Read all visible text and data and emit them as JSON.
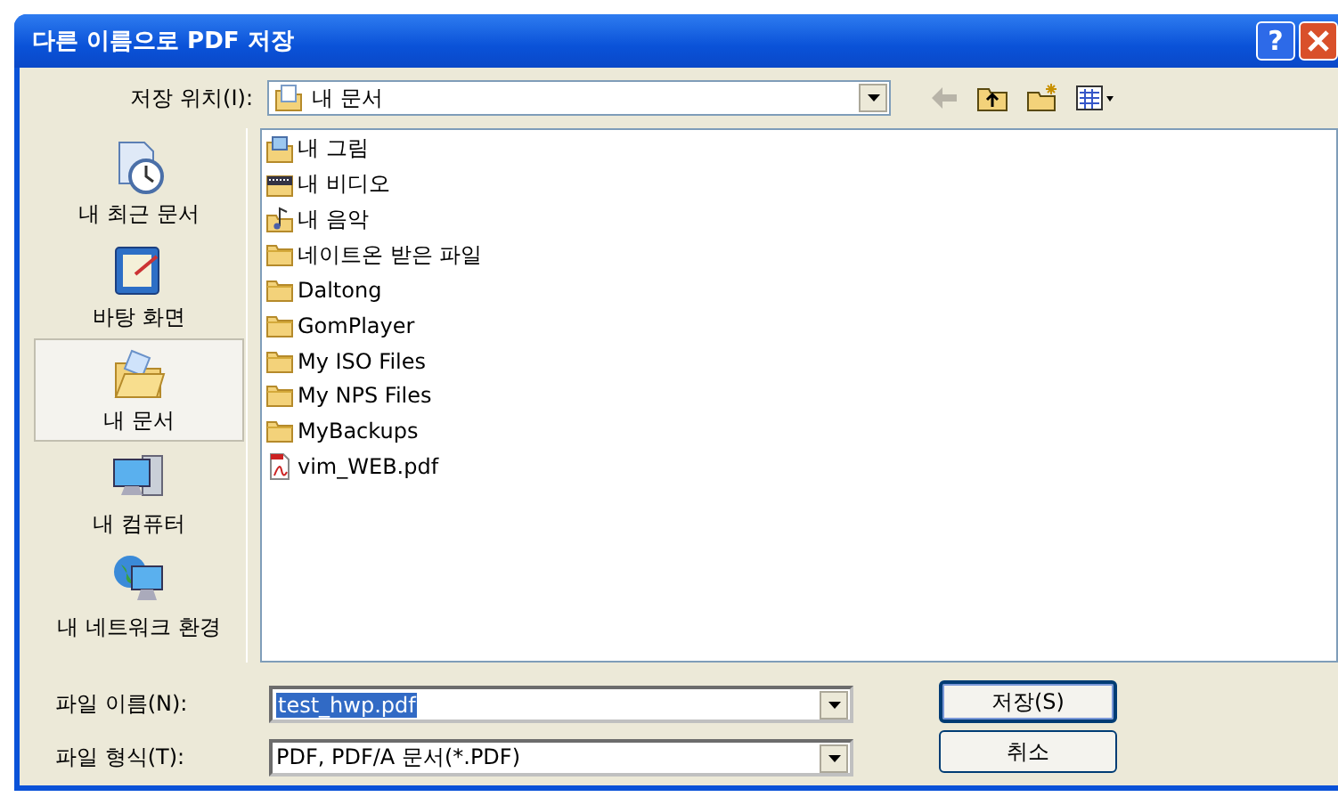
{
  "window": {
    "title": "다른 이름으로 PDF 저장",
    "help": "?"
  },
  "location": {
    "label": "저장 위치(I):",
    "value": "내 문서"
  },
  "places": [
    {
      "label": "내 최근 문서",
      "kind": "recent",
      "selected": false
    },
    {
      "label": "바탕 화면",
      "kind": "desktop",
      "selected": false
    },
    {
      "label": "내 문서",
      "kind": "documents",
      "selected": true
    },
    {
      "label": "내 컴퓨터",
      "kind": "computer",
      "selected": false
    },
    {
      "label": "내 네트워크 환경",
      "kind": "network",
      "selected": false
    }
  ],
  "files": [
    {
      "name": "내 그림",
      "kind": "pictures"
    },
    {
      "name": "내 비디오",
      "kind": "videos"
    },
    {
      "name": "내 음악",
      "kind": "music"
    },
    {
      "name": "네이트온 받은 파일",
      "kind": "folder"
    },
    {
      "name": "Daltong",
      "kind": "folder"
    },
    {
      "name": "GomPlayer",
      "kind": "folder"
    },
    {
      "name": "My ISO Files",
      "kind": "folder"
    },
    {
      "name": "My NPS Files",
      "kind": "folder"
    },
    {
      "name": "MyBackups",
      "kind": "folder"
    },
    {
      "name": "vim_WEB.pdf",
      "kind": "pdf"
    }
  ],
  "filename": {
    "label": "파일 이름(N):",
    "value": "test_hwp.pdf",
    "selected": true
  },
  "filetype": {
    "label": "파일 형식(T):",
    "value": "PDF, PDF/A 문서(*.PDF)"
  },
  "buttons": [
    {
      "label": "저장(S)",
      "default": true
    },
    {
      "label": "취소",
      "default": false
    }
  ]
}
